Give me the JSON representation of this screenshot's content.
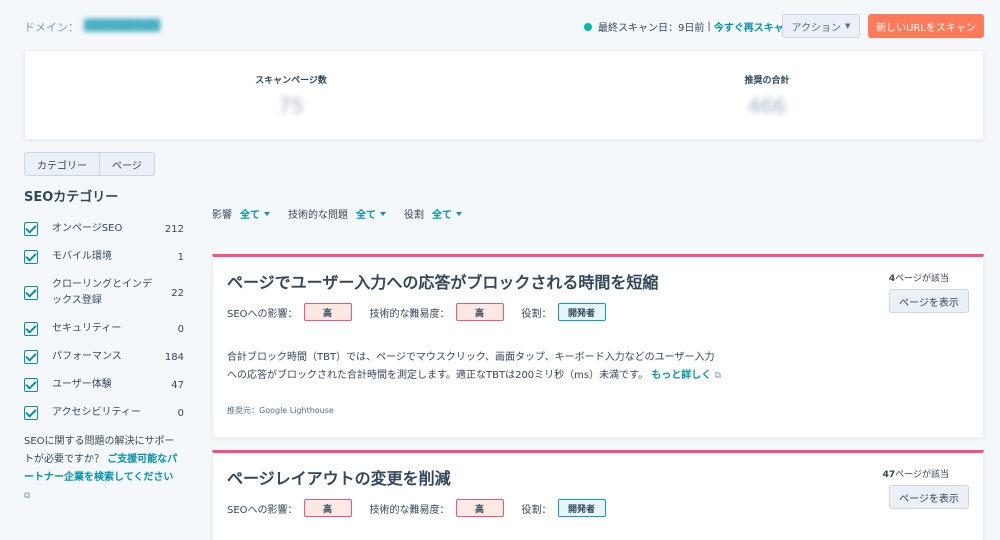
{
  "header": {
    "domain_label": "ドメイン：",
    "domain_value": "█████████",
    "last_scan_label": "最終スキャン日：9日前",
    "separator": "|",
    "rescan_link": "今すぐ再スキャン",
    "action_button": "アクション",
    "new_scan_button": "新しいURLをスキャン"
  },
  "stats": {
    "pages_label": "スキャンページ数",
    "pages_value": "75",
    "recs_label": "推奨の合計",
    "recs_value": "466"
  },
  "view_toggle": {
    "category": "カテゴリー",
    "page": "ページ"
  },
  "sidebar": {
    "title": "SEOカテゴリー",
    "items": [
      {
        "label": "オンページSEO",
        "count": "212"
      },
      {
        "label": "モバイル環境",
        "count": "1"
      },
      {
        "label": "クローリングとインデックス登録",
        "count": "22"
      },
      {
        "label": "セキュリティー",
        "count": "0"
      },
      {
        "label": "パフォーマンス",
        "count": "184"
      },
      {
        "label": "ユーザー体験",
        "count": "47"
      },
      {
        "label": "アクセシビリティー",
        "count": "0"
      }
    ],
    "support_text": "SEOに関する問題の解決にサポートが必要ですか？",
    "support_link": "ご支援可能なパートナー企業を検索してください"
  },
  "filters": {
    "impact_label": "影響",
    "impact_value": "全て",
    "tech_label": "技術的な問題",
    "tech_value": "全て",
    "role_label": "役割",
    "role_value": "全て"
  },
  "cards": [
    {
      "title": "ページでユーザー入力への応答がブロックされる時間を短縮",
      "page_count_num": "4",
      "page_count_suffix": "ページが該当",
      "view_button": "ページを表示",
      "impact_label": "SEOへの影響：",
      "impact_value": "高",
      "difficulty_label": "技術的な難易度：",
      "difficulty_value": "高",
      "role_label": "役割：",
      "role_value": "開発者",
      "description": "合計ブロック時間（TBT）では、ページでマウスクリック、画面タップ、キーボード入力などのユーザー入力への応答がブロックされた合計時間を測定します。適正なTBTは200ミリ秒（ms）未満です。",
      "more_link": "もっと詳しく",
      "source": "推奨元：Google Lighthouse"
    },
    {
      "title": "ページレイアウトの変更を削減",
      "page_count_num": "47",
      "page_count_suffix": "ページが該当",
      "view_button": "ページを表示",
      "impact_label": "SEOへの影響：",
      "impact_value": "高",
      "difficulty_label": "技術的な難易度：",
      "difficulty_value": "高",
      "role_label": "役割：",
      "role_value": "開発者"
    }
  ],
  "colors": {
    "accent": "#0091ae",
    "primary_button": "#ff7a59",
    "card_border_top": "#f2547d",
    "status_dot": "#00bda5"
  }
}
